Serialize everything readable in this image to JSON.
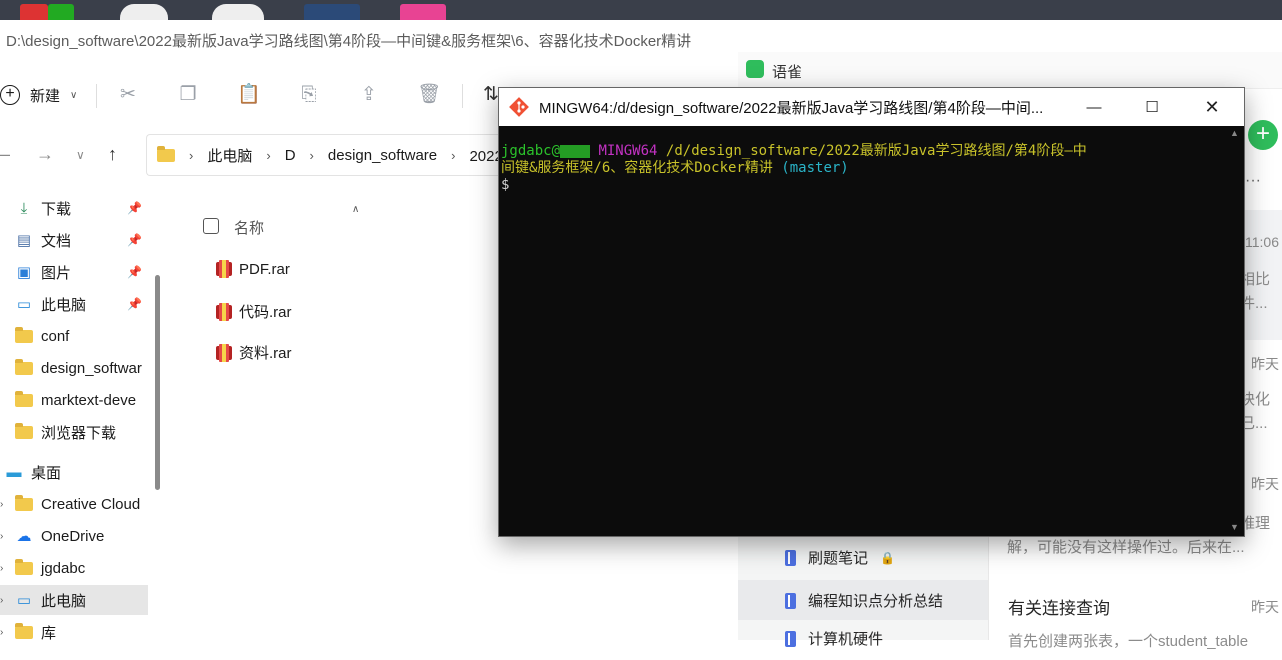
{
  "explorer": {
    "title": "D:\\design_software\\2022最新版Java学习路线图\\第4阶段—中间键&服务框架\\6、容器化技术Docker精讲",
    "new_label": "新建",
    "breadcrumb": [
      "此电脑",
      "D",
      "design_software",
      "2022最"
    ],
    "column_name": "名称",
    "sidebar": [
      {
        "label": "下载",
        "icon": "download-icon",
        "pinned": true
      },
      {
        "label": "文档",
        "icon": "document-icon",
        "pinned": true
      },
      {
        "label": "图片",
        "icon": "picture-icon",
        "pinned": true
      },
      {
        "label": "此电脑",
        "icon": "computer-icon",
        "pinned": true
      },
      {
        "label": "conf",
        "icon": "folder-icon",
        "pinned": false
      },
      {
        "label": "design_softwar",
        "icon": "folder-icon",
        "pinned": false
      },
      {
        "label": "marktext-deve",
        "icon": "folder-icon",
        "pinned": false
      },
      {
        "label": "浏览器下载",
        "icon": "folder-icon",
        "pinned": false
      },
      {
        "label": "桌面",
        "icon": "desktop-icon",
        "pinned": false
      },
      {
        "label": "Creative Cloud",
        "icon": "folder-icon",
        "pinned": false
      },
      {
        "label": "OneDrive",
        "icon": "cloud-icon",
        "pinned": false
      },
      {
        "label": "jgdabc",
        "icon": "folder-icon",
        "pinned": false
      },
      {
        "label": "此电脑",
        "icon": "computer-icon",
        "pinned": false
      },
      {
        "label": "库",
        "icon": "folder-icon",
        "pinned": false
      }
    ],
    "files": [
      "PDF.rar",
      "代码.rar",
      "资料.rar"
    ]
  },
  "terminal": {
    "title": "MINGW64:/d/design_software/2022最新版Java学习路线图/第4阶段—中间...",
    "user": "jgdabc@",
    "env": "MINGW64",
    "path_line1": "/d/design_software/2022最新版Java学习路线图/第4阶段—中",
    "path_line2": "间键&服务框架/6、容器化技术Docker精讲",
    "branch": "(master)",
    "prompt": "$"
  },
  "yuque": {
    "app_name": "语雀",
    "items": [
      {
        "time": "11:06",
        "snippet1": "相比",
        "snippet2": "件..."
      },
      {
        "time": "昨天",
        "snippet1": "块化",
        "snippet2": "已..."
      },
      {
        "time": "昨天",
        "snippet1": "推理",
        "snippet2": "解，可能没有这样操作过。后来在..."
      }
    ],
    "books": [
      "刷题笔记",
      "编程知识点分析总结",
      "计算机硬件"
    ],
    "doc_title": "有关连接查询",
    "doc_time": "昨天",
    "doc_snippet": "首先创建两张表，一个student_table"
  }
}
